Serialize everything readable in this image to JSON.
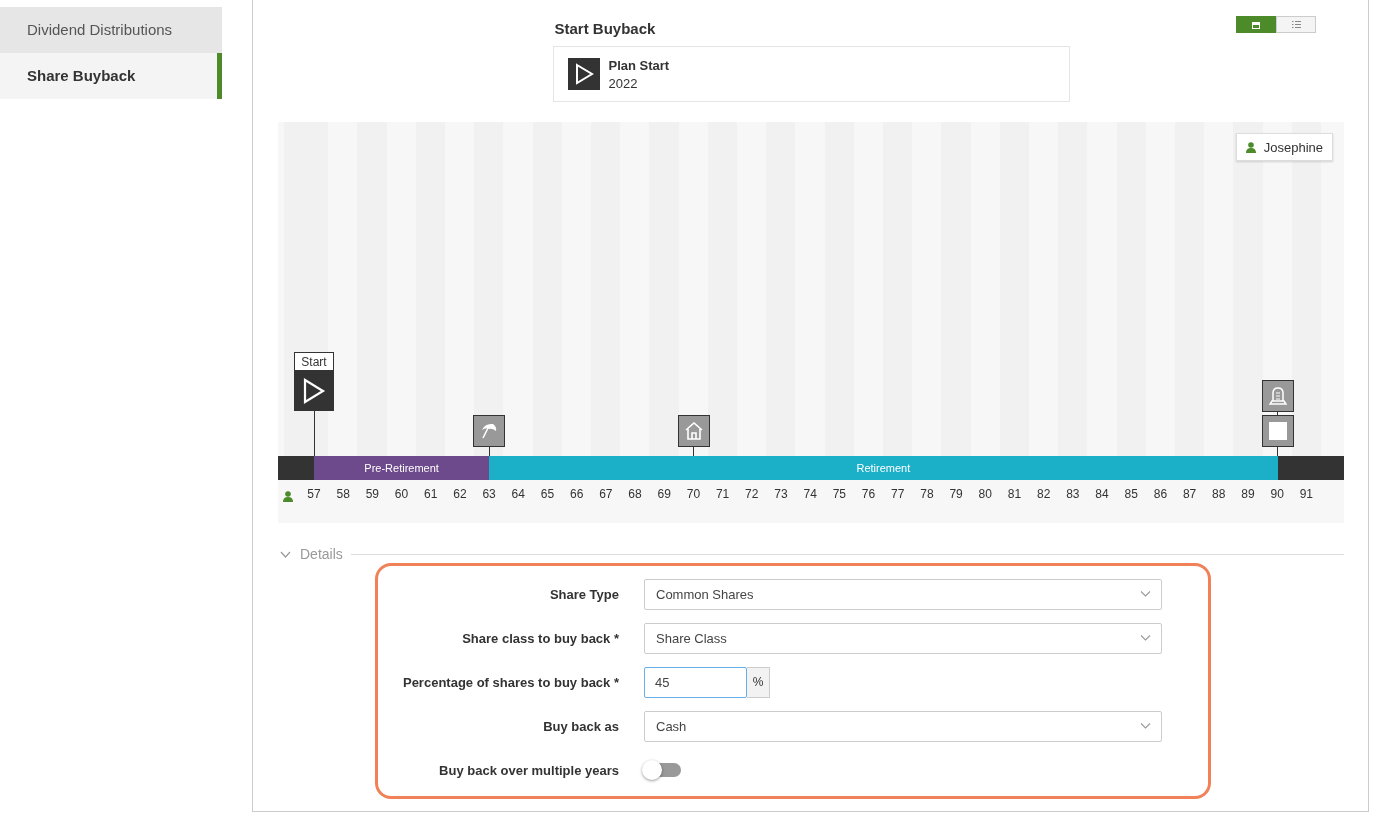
{
  "sidebar": {
    "items": [
      {
        "label": "Dividend Distributions",
        "selected": false,
        "hovered": true
      },
      {
        "label": "Share Buyback",
        "selected": true,
        "hovered": false
      }
    ]
  },
  "view_toggle": [
    {
      "kind": "calendar",
      "selected": true
    },
    {
      "kind": "list",
      "selected": false
    }
  ],
  "event": {
    "title": "Start Buyback",
    "name": "Plan Start",
    "year": "2022"
  },
  "timeline": {
    "person": "Josephine",
    "phases": [
      {
        "label": "Pre-Retirement"
      },
      {
        "label": "Retirement"
      }
    ],
    "ages": [
      {
        "label": "57",
        "color": "#6d4a8b",
        "markers": [
          {
            "kind": "start",
            "label": "Start"
          }
        ]
      },
      {
        "label": "58",
        "color": "#6d4a8b"
      },
      {
        "label": "59",
        "color": "#6d4a8b"
      },
      {
        "label": "60",
        "color": "#6d4a8b"
      },
      {
        "label": "61",
        "color": "#6d4a8b"
      },
      {
        "label": "62",
        "color": "#6d4a8b"
      },
      {
        "label": "63",
        "color": "#1cafc8",
        "markers": [
          {
            "kind": "retirement"
          }
        ]
      },
      {
        "label": "64",
        "color": "#1cafc8"
      },
      {
        "label": "65",
        "color": "#1cafc8"
      },
      {
        "label": "66",
        "color": "#1cafc8"
      },
      {
        "label": "67",
        "color": "#1cafc8"
      },
      {
        "label": "68",
        "color": "#1cafc8"
      },
      {
        "label": "69",
        "color": "#1cafc8"
      },
      {
        "label": "70",
        "color": "#1cafc8",
        "markers": [
          {
            "kind": "home"
          }
        ]
      },
      {
        "label": "71",
        "color": "#1cafc8"
      },
      {
        "label": "72",
        "color": "#1cafc8"
      },
      {
        "label": "73",
        "color": "#1cafc8"
      },
      {
        "label": "74",
        "color": "#1cafc8"
      },
      {
        "label": "75",
        "color": "#1cafc8"
      },
      {
        "label": "76",
        "color": "#1cafc8"
      },
      {
        "label": "77",
        "color": "#1cafc8"
      },
      {
        "label": "78",
        "color": "#1cafc8"
      },
      {
        "label": "79",
        "color": "#1cafc8"
      },
      {
        "label": "80",
        "color": "#1cafc8"
      },
      {
        "label": "81",
        "color": "#1cafc8"
      },
      {
        "label": "82",
        "color": "#1cafc8"
      },
      {
        "label": "83",
        "color": "#1cafc8"
      },
      {
        "label": "84",
        "color": "#1cafc8"
      },
      {
        "label": "85",
        "color": "#1cafc8"
      },
      {
        "label": "86",
        "color": "#1cafc8"
      },
      {
        "label": "87",
        "color": "#1cafc8"
      },
      {
        "label": "88",
        "color": "#1cafc8"
      },
      {
        "label": "89",
        "color": "#1cafc8"
      },
      {
        "label": "90",
        "color": "#333333",
        "markers": [
          {
            "kind": "death"
          },
          {
            "kind": "end"
          }
        ]
      },
      {
        "label": "91",
        "color": "#333333"
      }
    ]
  },
  "details": {
    "label": "Details",
    "expanded": true,
    "fields": [
      {
        "kind": "select",
        "label": "Share Type",
        "value": "Common Shares"
      },
      {
        "kind": "select",
        "label": "Share class to buy back *",
        "value": "Share Class"
      },
      {
        "kind": "number",
        "label": "Percentage of shares to buy back *",
        "value": "45",
        "unit": "%",
        "focused": true
      },
      {
        "kind": "select",
        "label": "Buy back as",
        "value": "Cash"
      },
      {
        "kind": "toggle",
        "label": "Buy back over multiple years",
        "on": false
      }
    ]
  }
}
